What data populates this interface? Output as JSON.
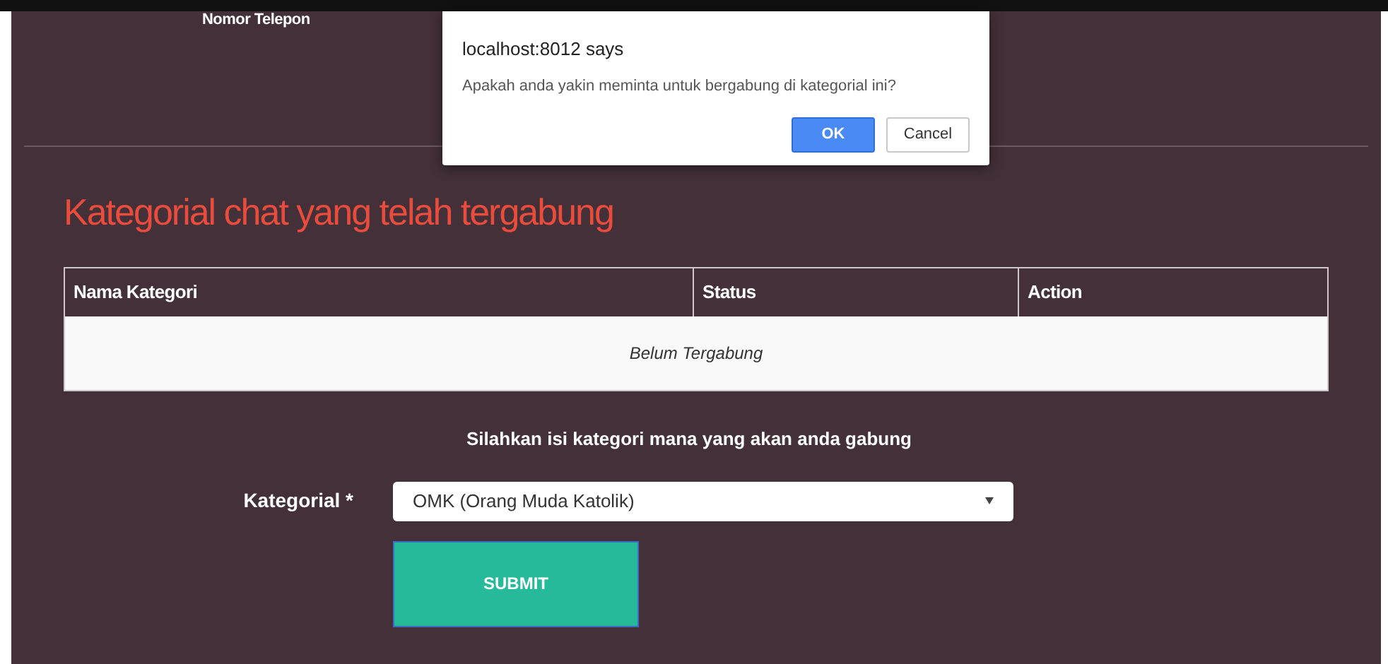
{
  "page": {
    "top_label": "Nomor Telepon",
    "section_title": "Kategorial chat yang telah tergabung",
    "table": {
      "columns": [
        "Nama Kategori",
        "Status",
        "Action"
      ],
      "empty_message": "Belum Tergabung"
    },
    "form": {
      "instruction": "Silahkan isi kategori mana yang akan anda gabung",
      "label": "Kategorial *",
      "select_value": "OMK (Orang Muda Katolik)",
      "submit": "SUBMIT"
    }
  },
  "dialog": {
    "title": "localhost:8012 says",
    "message": "Apakah anda yakin meminta untuk bergabung di kategorial ini?",
    "buttons": [
      {
        "label": "OK",
        "kind": "primary"
      },
      {
        "label": "Cancel",
        "kind": "secondary"
      }
    ]
  }
}
